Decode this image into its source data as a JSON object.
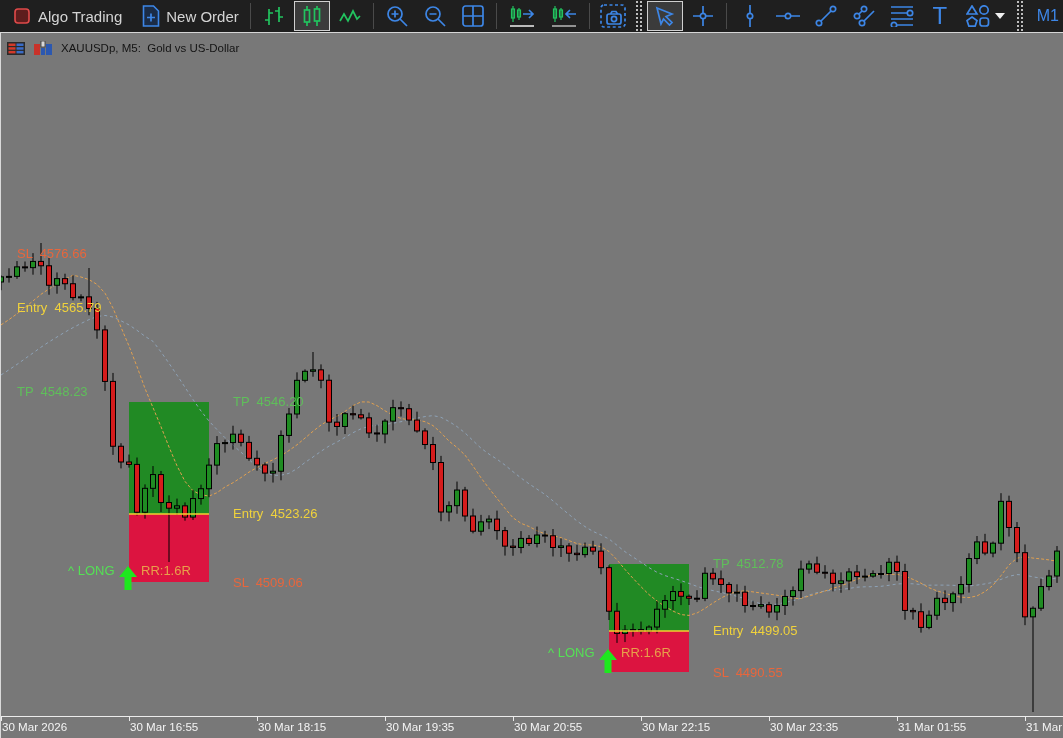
{
  "toolbar": {
    "algo_trading": {
      "label": "Algo Trading",
      "on": false
    },
    "new_order": {
      "label": "New Order"
    },
    "chart_types": [
      {
        "kind": "bars",
        "selected": false
      },
      {
        "kind": "candles",
        "selected": true
      },
      {
        "kind": "line",
        "selected": false
      }
    ],
    "zoom_tools": [
      {
        "kind": "zoomin"
      },
      {
        "kind": "zoomout"
      },
      {
        "kind": "tile"
      }
    ],
    "scroll_tools": [
      {
        "kind": "shift"
      },
      {
        "kind": "autoscroll"
      }
    ],
    "capture_tools": [
      {
        "kind": "screenshot"
      }
    ],
    "pointer_tools": [
      {
        "kind": "cursor",
        "selected": true
      },
      {
        "kind": "crosshair",
        "selected": false
      }
    ],
    "drawing_tools": [
      {
        "kind": "vline"
      },
      {
        "kind": "hline"
      },
      {
        "kind": "trend"
      },
      {
        "kind": "channel"
      },
      {
        "kind": "fibo"
      },
      {
        "kind": "text",
        "label": "T"
      },
      {
        "kind": "shapes"
      }
    ],
    "timeframes": [
      {
        "label": "M1",
        "selected": false
      }
    ]
  },
  "chart": {
    "title": "XAUUSDp, M5:  Gold vs US-Dollar",
    "signals": [
      {
        "sl": "SL  4576.66",
        "entry": "Entry  4565.79",
        "tp": "TP  4548.23"
      },
      {
        "tp": "TP  4546.20",
        "entry": "Entry  4523.26",
        "sl": "SL  4509.06",
        "direction": "^ LONG",
        "ratio": "RR:1.6R"
      },
      {
        "tp": "TP  4512.78",
        "entry": "Entry  4499.05",
        "sl": "SL  4490.55",
        "direction": "^ LONG",
        "ratio": "RR:1.6R"
      }
    ],
    "time_axis": [
      "30 Mar 2026",
      "30 Mar 16:55",
      "30 Mar 18:15",
      "30 Mar 19:35",
      "30 Mar 20:55",
      "30 Mar 22:15",
      "30 Mar 23:35",
      "31 Mar 01:55",
      "31 Mar"
    ]
  }
}
